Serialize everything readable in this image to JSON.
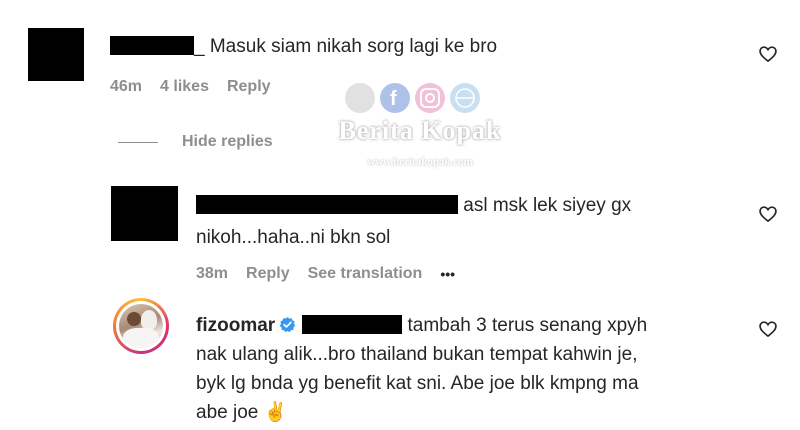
{
  "comments": [
    {
      "text": "Masuk siam nikah sorg lagi ke bro",
      "time": "46m",
      "likes": "4 likes",
      "reply": "Reply"
    }
  ],
  "hide_replies": "Hide replies",
  "replies": [
    {
      "line1": "asl msk lek siyey gx",
      "line2": "nikoh...haha..ni bkn sol",
      "time": "38m",
      "reply": "Reply",
      "translate": "See translation",
      "more": "•••"
    },
    {
      "username": "fizoomar",
      "line1": "tambah 3 terus senang xpyh",
      "line2": "nak ulang alik...bro thailand bukan tempat kahwin je,",
      "line3": "byk lg bnda yg benefit kat sni. Abe joe blk kmpng ma",
      "line4": "abe joe ✌"
    }
  ],
  "watermark": {
    "name": "Berita Kopak",
    "url": "www.beritakopak.com"
  },
  "colors": {
    "text": "#262626",
    "meta": "#8e8e8e",
    "verified": "#3897f0",
    "avatar_ring": "#e1306c"
  }
}
